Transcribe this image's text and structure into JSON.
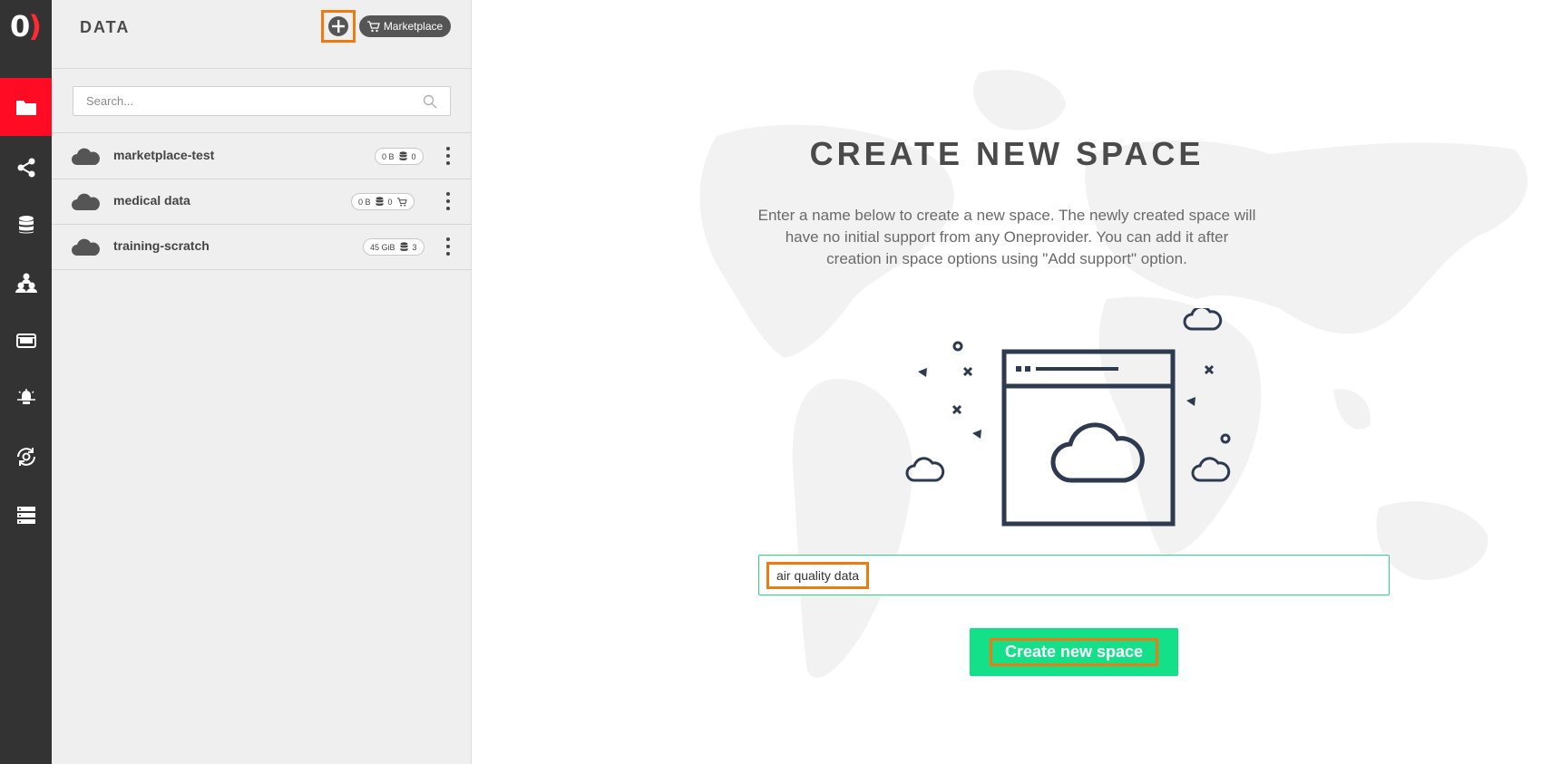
{
  "logo": {
    "letter1": "0",
    "letter2": ")"
  },
  "rail": {
    "items": [
      {
        "icon": "folder-icon",
        "active": true
      },
      {
        "icon": "share-icon"
      },
      {
        "icon": "database-icon"
      },
      {
        "icon": "groups-icon"
      },
      {
        "icon": "token-icon"
      },
      {
        "icon": "lightbulb-icon"
      },
      {
        "icon": "gear-sync-icon"
      },
      {
        "icon": "server-icon"
      }
    ]
  },
  "sidebar": {
    "title": "DATA",
    "marketplace_label": "Marketplace",
    "search": {
      "placeholder": "Search...",
      "value": ""
    },
    "spaces": [
      {
        "name": "marketplace-test",
        "size": "0 B",
        "providers": "0",
        "marketplace": false
      },
      {
        "name": "medical data",
        "size": "0 B",
        "providers": "0",
        "marketplace": true
      },
      {
        "name": "training-scratch",
        "size": "45 GiB",
        "providers": "3",
        "marketplace": false
      }
    ]
  },
  "main": {
    "title": "CREATE NEW SPACE",
    "description": "Enter a name below to create a new space. The newly created space will have no initial support from any Oneprovider. You can add it after creation in space options using \"Add support\" option.",
    "name_input_value": "air quality data",
    "create_button_label": "Create new space"
  },
  "colors": {
    "rail_bg": "#333333",
    "rail_active": "#ff0c24",
    "accent_green": "#15e08a",
    "highlight_orange": "#f07a10"
  }
}
